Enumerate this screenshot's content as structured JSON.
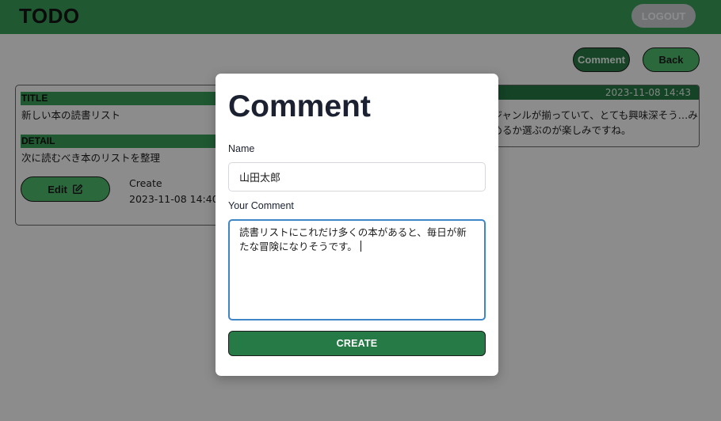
{
  "header": {
    "app_title": "TODO",
    "logout_label": "LOGOUT"
  },
  "toolbar": {
    "comment_label": "Comment",
    "back_label": "Back"
  },
  "todo_card": {
    "title_label": "TITLE",
    "title_value": "新しい本の読書リスト",
    "detail_label": "DETAIL",
    "detail_value": "次に読むべき本のリストを整理",
    "edit_label": "Edit",
    "create_label": "Create",
    "create_date": "2023-11-08 14:40"
  },
  "comment_card": {
    "timestamp": "2023-11-08 14:43",
    "text": "…ジャンルが揃っていて、とても興味深そう…み始めるか選ぶのが楽しみですね。"
  },
  "modal": {
    "title": "Comment",
    "name_label": "Name",
    "name_value": "山田太郎",
    "comment_label": "Your Comment",
    "comment_value": "読書リストにこれだけ多くの本があると、毎日が新たな冒険になりそうです。",
    "submit_label": "CREATE"
  },
  "colors": {
    "brand_green": "#3aa05a",
    "dark_green": "#257a45",
    "focus_blue": "#3f86c7"
  }
}
